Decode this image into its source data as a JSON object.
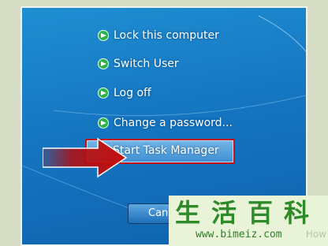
{
  "menu": {
    "items": [
      {
        "label": "Lock this computer",
        "icon": "green-arrow-icon"
      },
      {
        "label": "Switch User",
        "icon": "green-arrow-icon"
      },
      {
        "label": "Log off",
        "icon": "green-arrow-icon"
      },
      {
        "label": "Change a password...",
        "icon": "green-arrow-icon"
      },
      {
        "label": "Start Task Manager",
        "icon": "green-arrow-icon"
      }
    ]
  },
  "cancel_button": {
    "label": "Cancel"
  },
  "watermark": {
    "chars": [
      "生",
      "活",
      "百",
      "科"
    ],
    "url": "www.bimeiz.com",
    "suffix": "How"
  },
  "colors": {
    "background": "#1576c2",
    "highlight_border": "#c41212",
    "arrow_red": "#b40c0c",
    "watermark_green": "#2f8a2a"
  }
}
